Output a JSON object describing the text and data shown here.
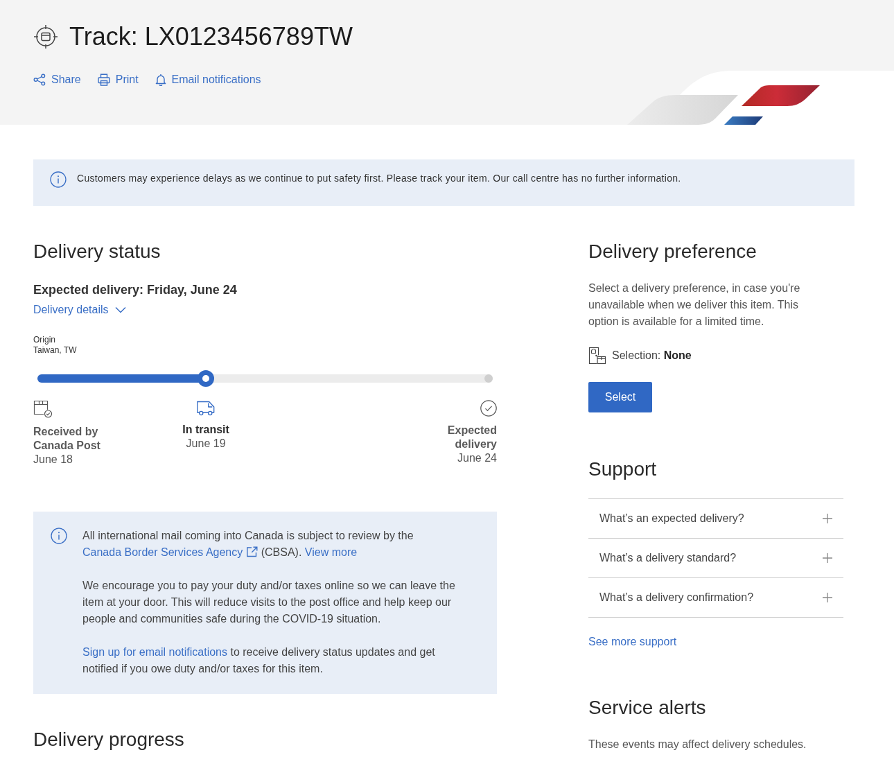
{
  "header": {
    "title": "Track: LX0123456789TW",
    "actions": [
      "Share",
      "Print",
      "Email notifications"
    ]
  },
  "notice": {
    "text": "Customers may experience delays as we continue to put safety first. Please track your item. Our call centre has no further information."
  },
  "delivery_status": {
    "heading": "Delivery status",
    "expected": "Expected delivery: Friday, June 24",
    "details_link": {
      "label": "Delivery details",
      "expanded": false
    },
    "origin": {
      "label": "Origin",
      "place": "Taiwan, TW"
    },
    "progress": {
      "level": 0.37
    },
    "steps": [
      {
        "title": "Received by Canada Post",
        "date": "June 18",
        "current": false
      },
      {
        "title": "In transit",
        "date": "June 19",
        "current": true
      },
      {
        "title": "Expected delivery",
        "date": "June 24",
        "current": false
      }
    ]
  },
  "delivery_preference": {
    "heading": "Delivery preference",
    "description": "Select a delivery preference, in case you're unavailable when we deliver this item. This option is available for a limited time.",
    "selection": "Selection: **None**",
    "button": "Select"
  },
  "customs_info": {
    "paragraphs": [
      [
        {
          "kind": "text",
          "text": "All international mail coming into Canada is subject to review by the "
        },
        {
          "kind": "link",
          "text": "Canada Border Services Agency",
          "external": true
        },
        {
          "kind": "text",
          "text": " (CBSA). "
        },
        {
          "kind": "link",
          "text": "View more",
          "external": false
        }
      ],
      [
        {
          "kind": "text",
          "text": "We encourage you to pay your duty and/or taxes online so we can leave the item at your door. This will reduce visits to the post office and help keep our people and communities safe during the COVID-19 situation."
        }
      ],
      [
        {
          "kind": "link",
          "text": "Sign up for email notifications",
          "external": false
        },
        {
          "kind": "text",
          "text": " to receive delivery status updates and get notified if you owe duty and/or taxes for this item."
        }
      ]
    ]
  },
  "support": {
    "heading": "Support",
    "questions": [
      {
        "text": "What’s an expected delivery?",
        "expanded": false
      },
      {
        "text": "What’s a delivery standard?",
        "expanded": false
      },
      {
        "text": "What’s a delivery confirmation?",
        "expanded": false
      }
    ],
    "more_link": "See more support"
  },
  "delivery_progress": {
    "heading": "Delivery progress"
  },
  "service_alerts": {
    "heading": "Service alerts",
    "text": "These events may affect delivery schedules."
  }
}
